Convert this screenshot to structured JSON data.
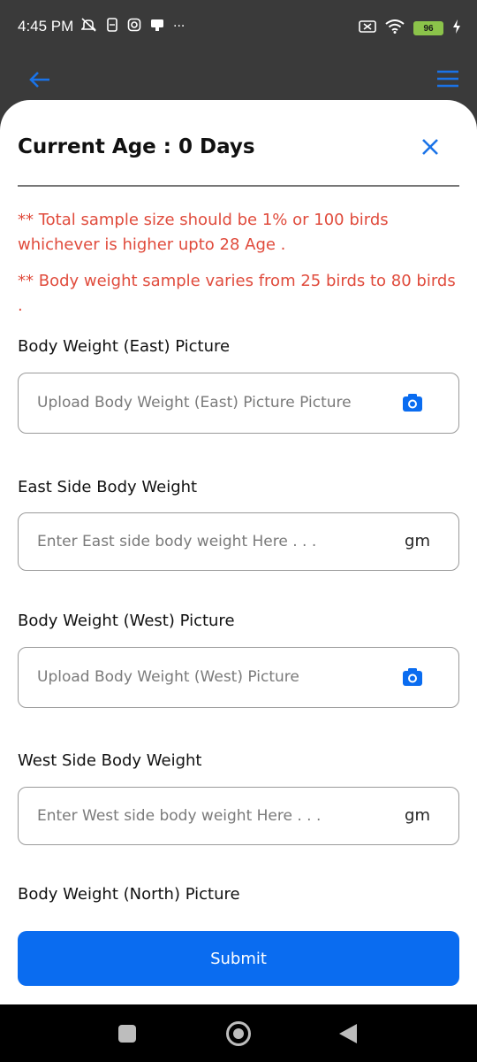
{
  "status_bar": {
    "time": "4:45 PM",
    "left_icons": [
      "mute-icon",
      "sim-icon",
      "instagram-icon",
      "notification-icon",
      "more-dots-icon"
    ],
    "more_text": "···",
    "battery_level": "96"
  },
  "app_bar": {
    "back_icon": "arrow-left-icon",
    "menu_icon": "hamburger-menu-icon",
    "accent": "#1a73e8"
  },
  "sheet": {
    "title": "Current Age : 0 Days",
    "close_icon": "close-icon",
    "notes": [
      "** Total sample size should be 1% or 100 birds whichever is higher upto 28 Age .",
      "** Body weight sample varies from 25 birds to 80 birds ."
    ],
    "fields": {
      "east_picture": {
        "label": "Body Weight (East) Picture",
        "placeholder": "Upload Body Weight (East) Picture Picture",
        "icon": "camera-icon"
      },
      "east_weight": {
        "label": "East Side Body Weight",
        "placeholder": "Enter East side body weight Here . . .",
        "unit": "gm"
      },
      "west_picture": {
        "label": "Body Weight (West) Picture",
        "placeholder": "Upload Body Weight (West) Picture",
        "icon": "camera-icon"
      },
      "west_weight": {
        "label": "West Side Body Weight",
        "placeholder": "Enter West side body weight Here . . .",
        "unit": "gm"
      },
      "north_picture": {
        "label": "Body Weight (North) Picture"
      }
    },
    "submit_label": "Submit"
  },
  "colors": {
    "primary": "#0a6cf0",
    "warning_text": "#e04b3c",
    "header_bg": "#3a3a3a"
  }
}
